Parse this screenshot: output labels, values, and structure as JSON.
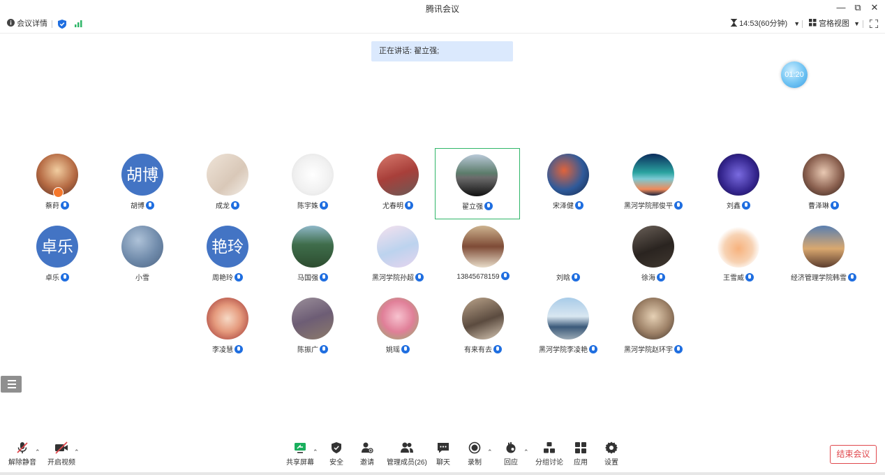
{
  "window": {
    "title": "腾讯会议"
  },
  "infobar": {
    "meeting_details": "会议详情",
    "timer_text": "14:53(60分钟)",
    "view_label": "宫格视图"
  },
  "speaking": {
    "text": "正在讲话: 翟立强;"
  },
  "elapsed": "01:20",
  "participants": [
    {
      "name": "蔡莳",
      "avatar": "photo",
      "host": true
    },
    {
      "name": "胡博",
      "avatar": "text",
      "initials": "胡博"
    },
    {
      "name": "成龙",
      "avatar": "photo"
    },
    {
      "name": "陈宇姝",
      "avatar": "photo"
    },
    {
      "name": "尤春明",
      "avatar": "photo"
    },
    {
      "name": "翟立强",
      "avatar": "photo",
      "active": true
    },
    {
      "name": "宋泽健",
      "avatar": "photo"
    },
    {
      "name": "黑河学院邢俊平",
      "avatar": "photo"
    },
    {
      "name": "刘鑫",
      "avatar": "photo"
    },
    {
      "name": "曹泽琳",
      "avatar": "photo"
    },
    {
      "name": "卓乐",
      "avatar": "text",
      "initials": "卓乐"
    },
    {
      "name": "小雪",
      "avatar": "photo",
      "no_mic": true
    },
    {
      "name": "周艳玲",
      "avatar": "text",
      "initials": "艳玲"
    },
    {
      "name": "马国强",
      "avatar": "photo"
    },
    {
      "name": "黑河学院孙超",
      "avatar": "photo"
    },
    {
      "name": "13845678159",
      "avatar": "photo"
    },
    {
      "name": "刘晗",
      "avatar": "photo"
    },
    {
      "name": "徐海",
      "avatar": "photo"
    },
    {
      "name": "王雪威",
      "avatar": "photo"
    },
    {
      "name": "经济管理学院韩雪",
      "avatar": "photo"
    },
    {
      "name": "李凌慧",
      "avatar": "photo"
    },
    {
      "name": "陈振广",
      "avatar": "photo"
    },
    {
      "name": "姚瑶",
      "avatar": "photo"
    },
    {
      "name": "有来有去",
      "avatar": "photo"
    },
    {
      "name": "黑河学院李凌艳",
      "avatar": "photo"
    },
    {
      "name": "黑河学院赵环宇",
      "avatar": "photo"
    }
  ],
  "toolbar": {
    "unmute": "解除静音",
    "start_video": "开启视频",
    "share_screen": "共享屏幕",
    "security": "安全",
    "invite": "邀请",
    "manage_members": "管理成员(26)",
    "chat": "聊天",
    "record": "录制",
    "react": "回应",
    "breakout": "分组讨论",
    "apps": "应用",
    "settings": "设置",
    "end_meeting": "结束会议"
  }
}
